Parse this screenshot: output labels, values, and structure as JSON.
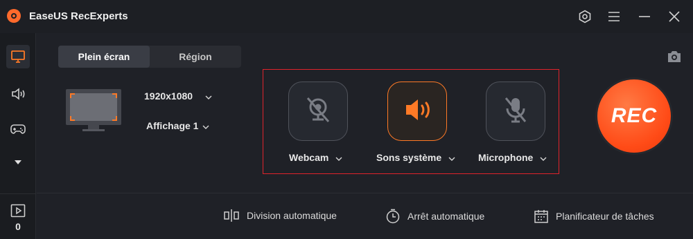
{
  "app": {
    "title": "EaseUS RecExperts"
  },
  "titlebar": {
    "icons": [
      "settings-hex-icon",
      "menu-icon",
      "minimize-icon",
      "close-icon"
    ]
  },
  "sidebar": {
    "items": [
      "screen-icon",
      "audio-icon",
      "gamepad-icon",
      "more-triangle-icon"
    ],
    "recordings_count": "0"
  },
  "mode_tabs": [
    {
      "label": "Plein écran",
      "active": true
    },
    {
      "label": "Région",
      "active": false
    }
  ],
  "display": {
    "resolution": "1920x1080",
    "monitor": "Affichage 1"
  },
  "sources": [
    {
      "label": "Webcam",
      "state": "off",
      "icon": "webcam-off-icon"
    },
    {
      "label": "Sons système",
      "state": "on",
      "icon": "speaker-icon"
    },
    {
      "label": "Microphone",
      "state": "off",
      "icon": "microphone-off-icon"
    }
  ],
  "record_button": {
    "label": "REC"
  },
  "footer": {
    "auto_split": "Division automatique",
    "auto_stop": "Arrêt automatique",
    "scheduler": "Planificateur de tâches"
  },
  "colors": {
    "accent": "#ff6a2c",
    "highlight_border": "#e1232b",
    "background": "#1f2127"
  }
}
